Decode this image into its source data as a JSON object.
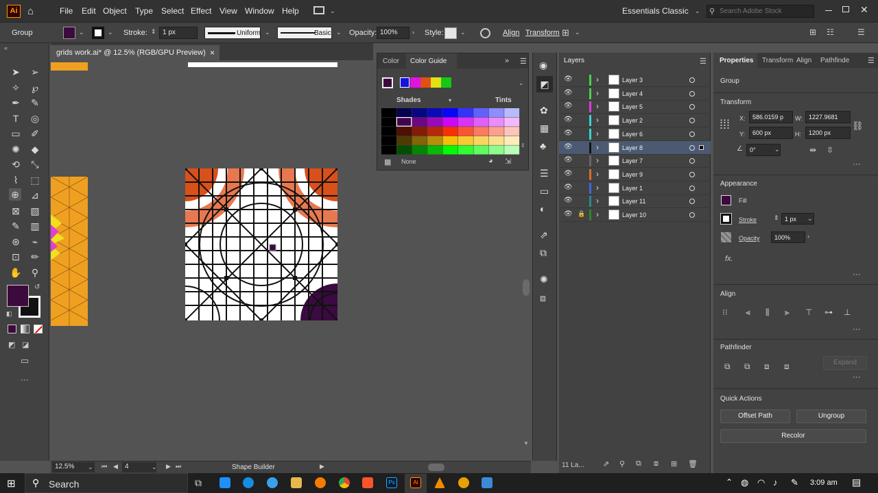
{
  "menubar": {
    "logo": "Ai",
    "items": [
      "File",
      "Edit",
      "Object",
      "Type",
      "Select",
      "Effect",
      "View",
      "Window",
      "Help"
    ],
    "workspace": "Essentials Classic",
    "search_placeholder": "Search Adobe Stock"
  },
  "control": {
    "selection": "Group",
    "stroke_label": "Stroke:",
    "stroke_weight": "1 px",
    "profile": "Uniform",
    "brush": "Basic",
    "opacity_label": "Opacity:",
    "opacity": "100%",
    "style_label": "Style:",
    "align": "Align",
    "transform": "Transform"
  },
  "document": {
    "tab": "grids work.ai* @ 12.5% (RGB/GPU Preview)",
    "close": "×"
  },
  "status": {
    "zoom": "12.5%",
    "artboard": "4",
    "tool": "Shape Builder"
  },
  "colorpanel": {
    "tab_color": "Color",
    "tab_guide": "Color Guide",
    "shades": "Shades",
    "tints": "Tints",
    "none": "None",
    "harmony": [
      "#1414e0",
      "#e014e0",
      "#e05014",
      "#e0e014",
      "#14c814"
    ],
    "colors": {
      "fill": "#3d0a3d",
      "accent": "#31a8ff",
      "artboard_orange": "#f0a020",
      "arc_orange": "#e8784f",
      "arc_dark": "#d8501a",
      "arc_purple": "#3a0a40"
    }
  },
  "layers": {
    "title": "Layers",
    "count": "11 La...",
    "items": [
      {
        "name": "Layer 3",
        "color": "#4ad34a"
      },
      {
        "name": "Layer 4",
        "color": "#4ad34a"
      },
      {
        "name": "Layer 5",
        "color": "#e03ae0"
      },
      {
        "name": "Layer 2",
        "color": "#3ad3d3"
      },
      {
        "name": "Layer 6",
        "color": "#3ad3d3"
      },
      {
        "name": "Layer 8",
        "color": "#111111"
      },
      {
        "name": "Layer 7",
        "color": "#666666"
      },
      {
        "name": "Layer 9",
        "color": "#e06a2a"
      },
      {
        "name": "Layer 1",
        "color": "#3a6ae0"
      },
      {
        "name": "Layer 11",
        "color": "#2a8a8a"
      },
      {
        "name": "Layer 10",
        "color": "#2a8a2a"
      }
    ]
  },
  "properties": {
    "tabs": [
      "Properties",
      "Transform",
      "Align",
      "Pathfinde"
    ],
    "group": "Group",
    "transform": "Transform",
    "x_label": "X:",
    "x": "586.0159 p",
    "y_label": "Y:",
    "y": "600 px",
    "w_label": "W:",
    "w": "1227.9681",
    "h_label": "H:",
    "h": "1200 px",
    "angle": "0°",
    "appearance": "Appearance",
    "fill": "Fill",
    "stroke": "Stroke",
    "stroke_val": "1 px",
    "opacity": "Opacity",
    "opacity_val": "100%",
    "fx": "fx.",
    "align": "Align",
    "pathfinder": "Pathfinder",
    "expand": "Expand",
    "quick_actions": "Quick Actions",
    "offset_path": "Offset Path",
    "ungroup": "Ungroup",
    "recolor": "Recolor"
  },
  "taskbar": {
    "search": "Search",
    "time": "3:09 am"
  }
}
